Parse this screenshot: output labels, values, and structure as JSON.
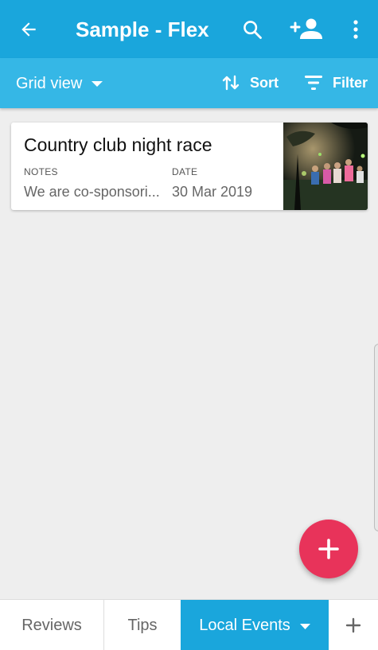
{
  "app_bar": {
    "title": "Sample - Flex",
    "background": "#1aa6dc",
    "icons": [
      "back-arrow-icon",
      "search-icon",
      "add-person-icon",
      "more-vert-icon"
    ]
  },
  "toolbar": {
    "view_label": "Grid view",
    "sort_label": "Sort",
    "filter_label": "Filter",
    "background": "#35b7e6"
  },
  "records": [
    {
      "title": "Country club night race",
      "fields": [
        {
          "label": "NOTES",
          "value": "We are co-sponsori..."
        },
        {
          "label": "DATE",
          "value": "30 Mar 2019"
        }
      ]
    }
  ],
  "fab": {
    "icon": "plus-icon",
    "color": "#e8335a"
  },
  "tabs": [
    {
      "label": "Reviews",
      "active": false
    },
    {
      "label": "Tips",
      "active": false
    },
    {
      "label": "Local Events",
      "active": true
    }
  ],
  "add_tab_icon": "plus-icon"
}
